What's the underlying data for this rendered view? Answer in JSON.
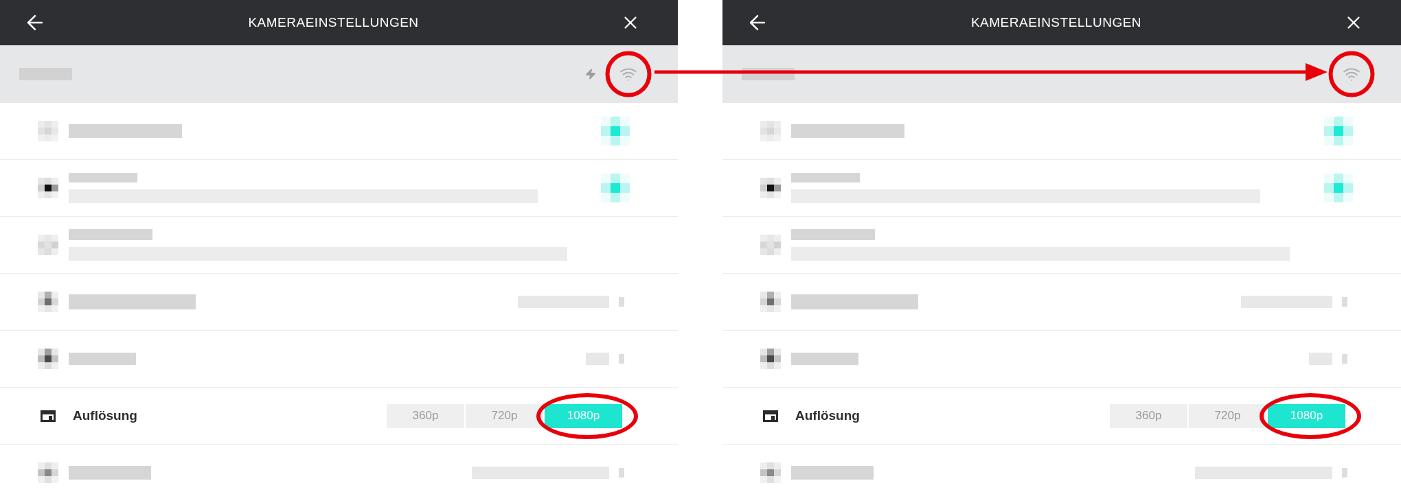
{
  "panels": [
    {
      "header": {
        "title": "KAMERAEINSTELLUNGEN"
      },
      "status_bar": {
        "power_indicator": true,
        "wifi_highlighted": true
      },
      "rows": [
        {
          "kind": "toggle",
          "on": true
        },
        {
          "kind": "toggle_detail",
          "on": true
        },
        {
          "kind": "detail"
        },
        {
          "kind": "value"
        },
        {
          "kind": "value"
        },
        {
          "kind": "resolution",
          "label": "Auflösung",
          "highlighted": true,
          "options": [
            {
              "label": "360p",
              "selected": false
            },
            {
              "label": "720p",
              "selected": false
            },
            {
              "label": "1080p",
              "selected": true
            }
          ]
        },
        {
          "kind": "value"
        }
      ]
    },
    {
      "header": {
        "title": "KAMERAEINSTELLUNGEN"
      },
      "status_bar": {
        "power_indicator": false,
        "wifi_highlighted": true
      },
      "rows": [
        {
          "kind": "toggle",
          "on": true
        },
        {
          "kind": "toggle_detail",
          "on": true
        },
        {
          "kind": "detail"
        },
        {
          "kind": "value"
        },
        {
          "kind": "value"
        },
        {
          "kind": "resolution",
          "label": "Auflösung",
          "highlighted": true,
          "options": [
            {
              "label": "360p",
              "selected": false
            },
            {
              "label": "720p",
              "selected": false
            },
            {
              "label": "1080p",
              "selected": true
            }
          ]
        },
        {
          "kind": "value"
        }
      ]
    }
  ],
  "connector_arrow": true
}
